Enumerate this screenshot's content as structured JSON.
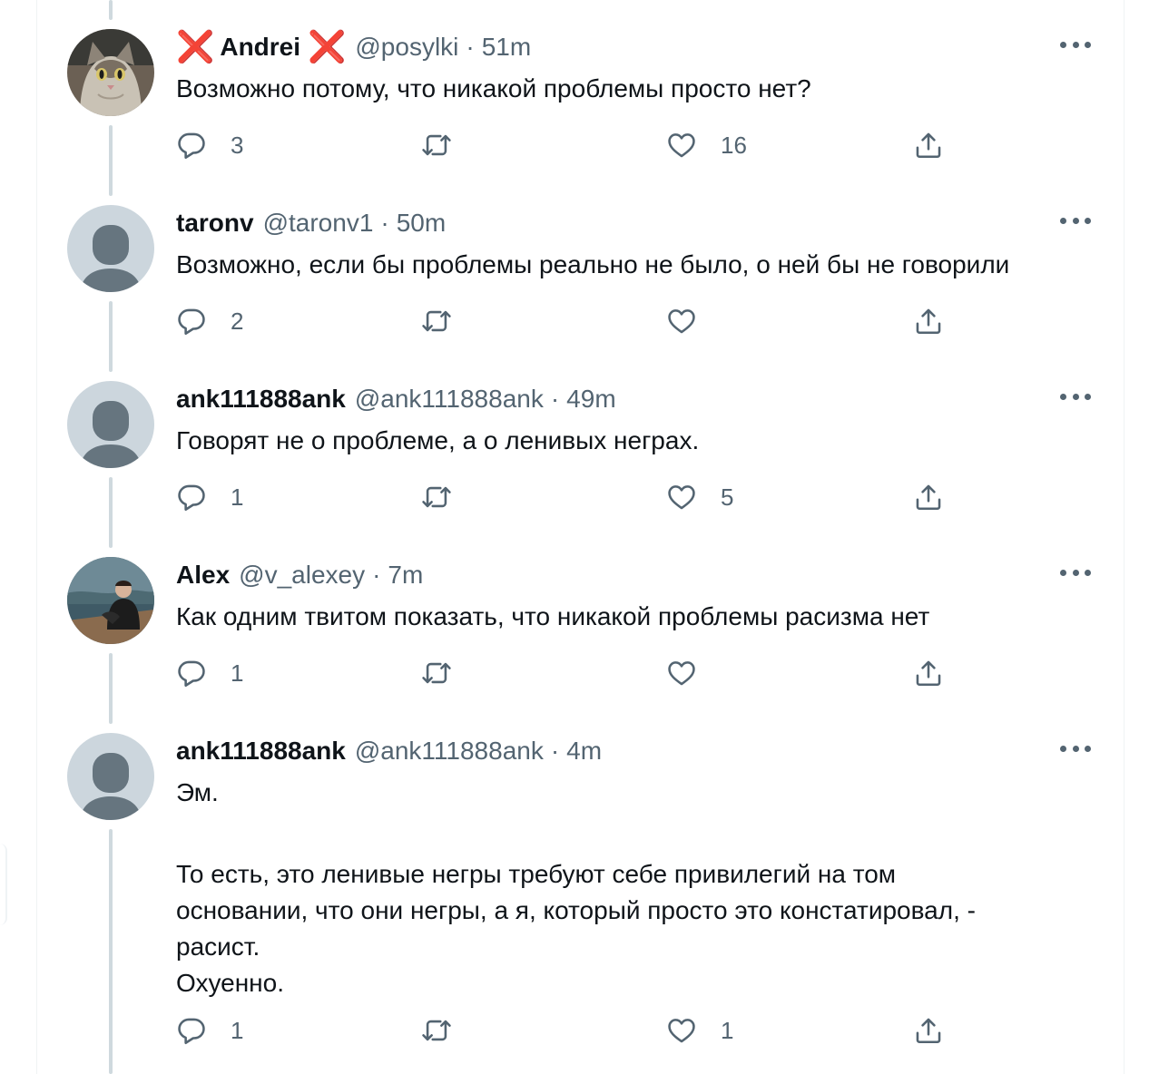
{
  "tweets": [
    {
      "display_name": "Andrei",
      "name_badges": [
        "❌",
        "❌"
      ],
      "handle": "@posylki",
      "time": "51m",
      "avatar": "cat-photo-avatar",
      "text": [
        "Возможно потому, что никакой проблемы просто нет?"
      ],
      "replies": "3",
      "retweets": "",
      "likes": "16"
    },
    {
      "display_name": "taronv",
      "handle": "@taronv1",
      "time": "50m",
      "avatar": "default-avatar",
      "text": [
        "Возможно, если бы проблемы реально не было, о ней бы не говорили"
      ],
      "replies": "2",
      "retweets": "",
      "likes": ""
    },
    {
      "display_name": "ank111888ank",
      "handle": "@ank111888ank",
      "time": "49m",
      "avatar": "default-avatar",
      "text": [
        "Говорят не о проблеме, а о ленивых неграх."
      ],
      "replies": "1",
      "retweets": "",
      "likes": "5"
    },
    {
      "display_name": "Alex",
      "handle": "@v_alexey",
      "time": "7m",
      "avatar": "person-photo-avatar",
      "text": [
        "Как одним твитом показать, что никакой проблемы расизма нет"
      ],
      "replies": "1",
      "retweets": "",
      "likes": ""
    },
    {
      "display_name": "ank111888ank",
      "handle": "@ank111888ank",
      "time": "4m",
      "avatar": "default-avatar",
      "text": [
        "Эм.",
        "",
        "То есть, это ленивые негры требуют себе привилегий на том",
        "основании, что они негры, а я, который просто это констатировал, -",
        "расист.",
        "Охуенно."
      ],
      "replies": "1",
      "retweets": "",
      "likes": "1"
    }
  ],
  "separator": "·",
  "icons": {
    "reply": "reply-bubble-icon",
    "retweet": "retweet-icon",
    "like": "heart-icon",
    "share": "share-upload-icon",
    "more": "more-dots-icon"
  },
  "colors": {
    "text": "#0f1419",
    "secondary": "#536471",
    "thread_line": "#cfd9de",
    "badge_red": "#e0245e",
    "default_avatar_bg": "#ccd6dd",
    "default_avatar_fg": "#66757f"
  }
}
